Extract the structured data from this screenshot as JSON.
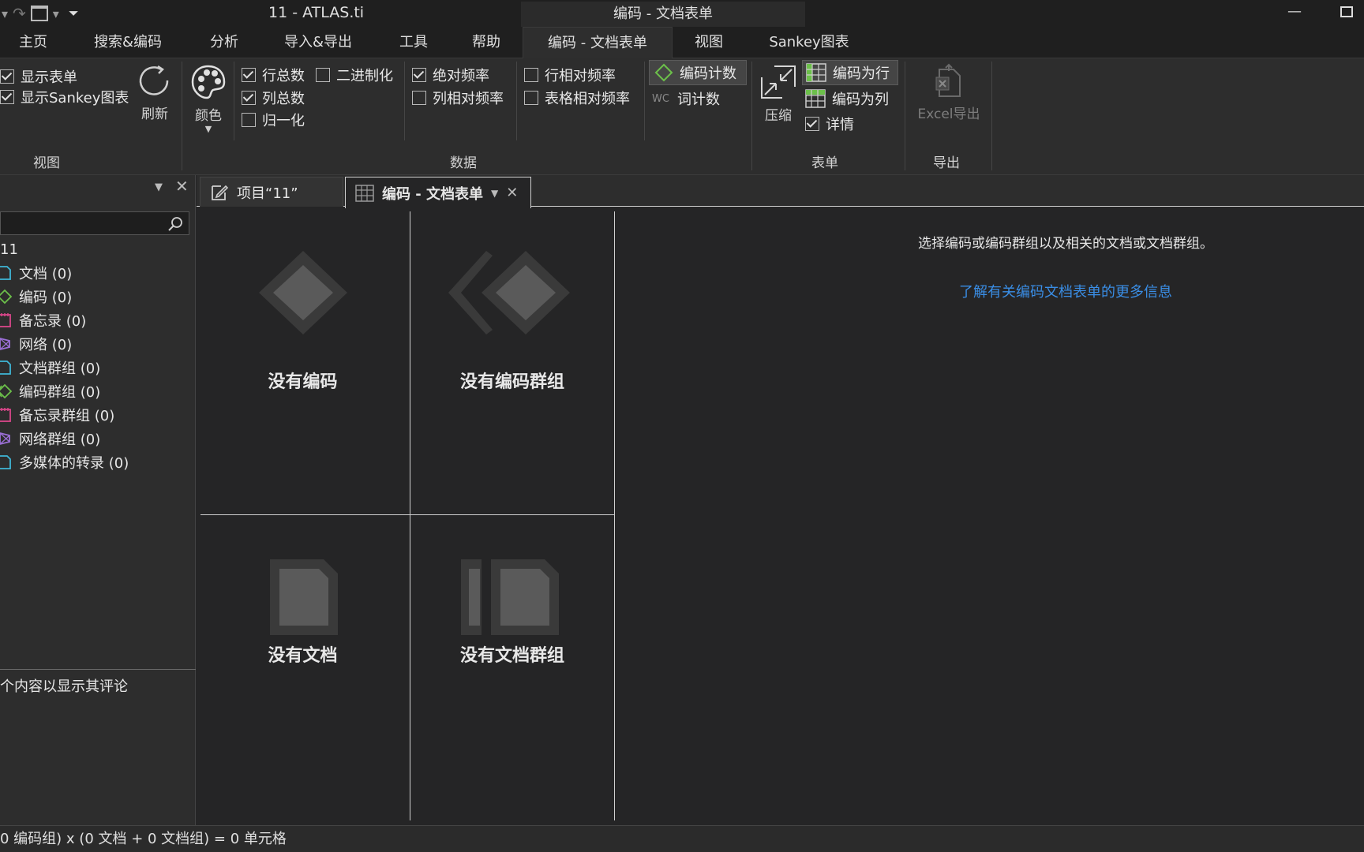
{
  "window": {
    "app_title": "11 - ATLAS.ti",
    "context_title": "编码 - 文档表单"
  },
  "menu": {
    "tabs": [
      "主页",
      "搜索&编码",
      "分析",
      "导入&导出",
      "工具",
      "帮助",
      "编码 - 文档表单",
      "视图",
      "Sankey图表"
    ]
  },
  "ribbon": {
    "view": {
      "show_table": "显示表单",
      "show_sankey": "显示Sankey图表",
      "refresh": "刷新",
      "group_label": "视图"
    },
    "color": {
      "label": "颜色"
    },
    "data": {
      "row_totals": "行总数",
      "binarize": "二进制化",
      "col_totals": "列总数",
      "normalize": "归一化",
      "abs_freq": "绝对频率",
      "col_rel_freq": "列相对频率",
      "row_rel_freq": "行相对频率",
      "table_rel_freq": "表格相对频率",
      "code_count": "编码计数",
      "wc_badge": "WC",
      "word_count": "词计数",
      "group_label": "数据"
    },
    "table": {
      "compress": "压缩",
      "codes_as_rows": "编码为行",
      "codes_as_cols": "编码为列",
      "details": "详情",
      "group_label": "表单"
    },
    "export": {
      "excel_export": "Excel导出",
      "group_label": "导出"
    },
    "checks": {
      "show_table": true,
      "show_sankey": true,
      "row_totals": true,
      "binarize": false,
      "col_totals": true,
      "normalize": false,
      "abs_freq": true,
      "col_rel_freq": false,
      "row_rel_freq": false,
      "table_rel_freq": false,
      "details": true
    }
  },
  "tabs": {
    "project_tab": "项目“11”",
    "active_tab": "编码 - 文档表单"
  },
  "left_panel": {
    "project_name": "11",
    "items": [
      {
        "label": "文档 (0)",
        "color": "#3fb6d6"
      },
      {
        "label": "编码 (0)",
        "color": "#6cc04a"
      },
      {
        "label": "备忘录 (0)",
        "color": "#d9468a"
      },
      {
        "label": "网络 (0)",
        "color": "#9b6fd6"
      },
      {
        "label": "文档群组 (0)",
        "color": "#3fb6d6"
      },
      {
        "label": "编码群组 (0)",
        "color": "#6cc04a"
      },
      {
        "label": "备忘录群组 (0)",
        "color": "#d9468a"
      },
      {
        "label": "网络群组 (0)",
        "color": "#9b6fd6"
      },
      {
        "label": "多媒体的转录 (0)",
        "color": "#3fb6d6"
      }
    ],
    "comment_hint": "个内容以显示其评论"
  },
  "main": {
    "no_codes": "没有编码",
    "no_code_groups": "没有编码群组",
    "no_documents": "没有文档",
    "no_document_groups": "没有文档群组",
    "hint": "选择编码或编码群组以及相关的文档或文档群组。",
    "learn_more": "了解有关编码文档表单的更多信息",
    "link_color": "#3a8ee6"
  },
  "status": {
    "text": "0 编码组) x (0 文档 + 0 文档组) = 0 单元格"
  }
}
